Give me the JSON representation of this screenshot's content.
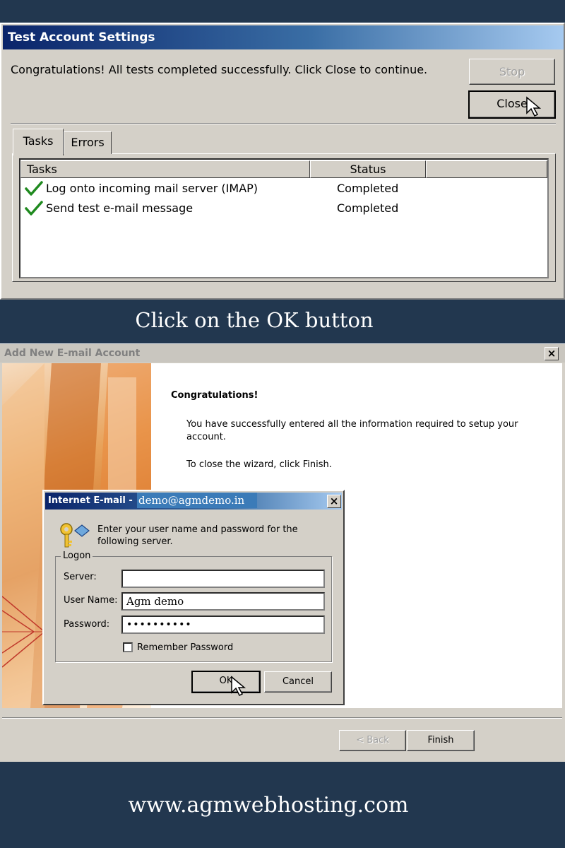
{
  "test_account": {
    "title": "Test Account Settings",
    "message": "Congratulations! All tests completed successfully. Click Close to continue.",
    "stop_label": "Stop",
    "close_label": "Close",
    "tabs": [
      {
        "label": "Tasks",
        "active": true
      },
      {
        "label": "Errors",
        "active": false
      }
    ],
    "columns": [
      "Tasks",
      "Status"
    ],
    "rows": [
      {
        "task": "Log onto incoming mail server (IMAP)",
        "status": "Completed"
      },
      {
        "task": "Send test e-mail message",
        "status": "Completed"
      }
    ],
    "check_color": "#1f8a1f"
  },
  "caption_top": "Click on the OK button",
  "add_account": {
    "title": "Add New E-mail Account",
    "heading": "Congratulations!",
    "paragraph1": "You have successfully entered all the information required to setup your account.",
    "paragraph2": "To close the wizard, click Finish.",
    "back_label": "< Back",
    "finish_label": "Finish"
  },
  "internet_email": {
    "title": "Internet E-mail -",
    "account": "demo@agmdemo.in",
    "prompt": "Enter your user name and password for the following server.",
    "group_label": "Logon",
    "server_label": "Server:",
    "server_value": "",
    "username_label": "User Name:",
    "username_value": "Agm demo",
    "password_label": "Password:",
    "password_value": "••••••••••",
    "remember_label": "Remember Password",
    "remember_checked": false,
    "ok_label": "OK",
    "cancel_label": "Cancel"
  },
  "footer_url": "www.agmwebhosting.com",
  "colors": {
    "background": "#22374f",
    "dialog": "#d4d0c8",
    "titlebar_active": "#0a246a"
  }
}
